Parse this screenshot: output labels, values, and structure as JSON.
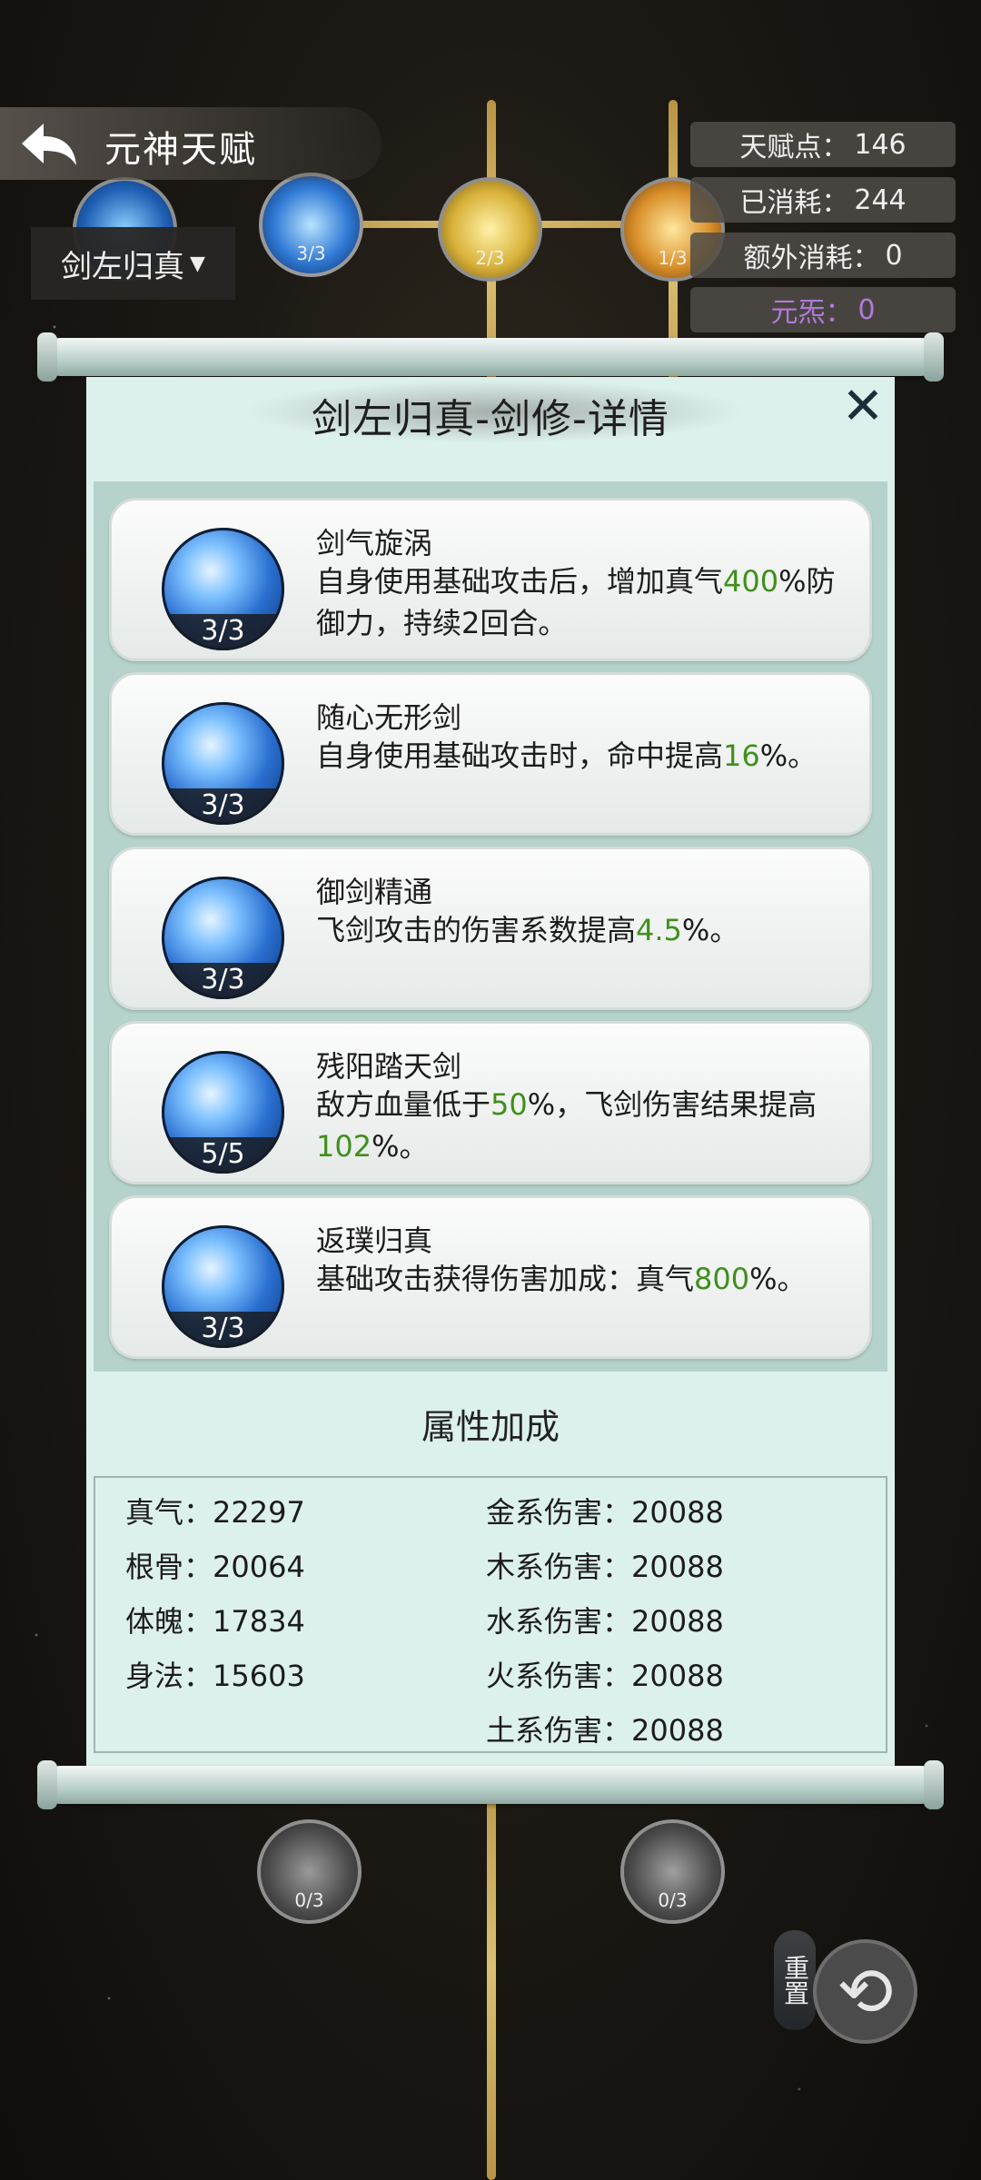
{
  "header": {
    "title": "元神天赋",
    "tree_selector": "剑左归真"
  },
  "stats": {
    "talent_points_label": "天赋点：",
    "talent_points": "146",
    "consumed_label": "已消耗：",
    "consumed": "244",
    "extra_label": "额外消耗：",
    "extra": "0",
    "element_label": "元炁：",
    "element": "0"
  },
  "tree_nodes_top": [
    {
      "level": "3/3"
    },
    {
      "level": "2/3"
    },
    {
      "level": "1/3"
    }
  ],
  "tree_nodes_bottom": [
    {
      "level": "0/3"
    },
    {
      "level": "0/3"
    }
  ],
  "panel": {
    "title": "剑左归真-剑修-详情",
    "skills": [
      {
        "name": "剑气旋涡",
        "level": "3/3",
        "desc_a": "自身使用基础攻击后，增加真气",
        "hl1": "400",
        "desc_b": "%防御力，持续2回合。"
      },
      {
        "name": "随心无形剑",
        "level": "3/3",
        "desc_a": "自身使用基础攻击时，命中提高",
        "hl1": "16",
        "desc_b": "%。"
      },
      {
        "name": "御剑精通",
        "level": "3/3",
        "desc_a": "飞剑攻击的伤害系数提高",
        "hl1": "4.5",
        "desc_b": "%。"
      },
      {
        "name": "残阳踏天剑",
        "level": "5/5",
        "desc_a": "敌方血量低于",
        "hl1": "50",
        "desc_b": "%，飞剑伤害结果提高",
        "hl2": "102",
        "desc_c": "%。"
      },
      {
        "name": "返璞归真",
        "level": "3/3",
        "desc_a": "基础攻击获得伤害加成：真气",
        "hl1": "800",
        "desc_b": "%。"
      }
    ],
    "attr_title": "属性加成",
    "attrs_left": [
      "真气：22297",
      "根骨：20064",
      "体魄：17834",
      "身法：15603"
    ],
    "attrs_right": [
      "金系伤害：20088",
      "木系伤害：20088",
      "水系伤害：20088",
      "火系伤害：20088",
      "土系伤害：20088"
    ]
  },
  "footer": {
    "reset_label": "重置"
  },
  "colors": {
    "highlight": "#3f8f1c",
    "element_text": "#b07ad8",
    "panel_bg": "#ddf1ec"
  }
}
